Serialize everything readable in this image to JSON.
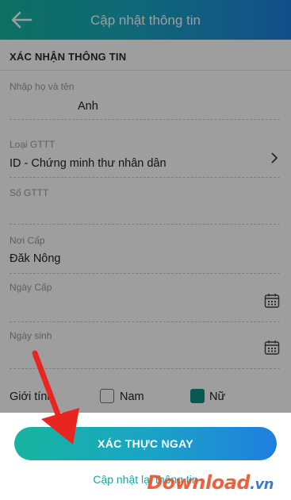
{
  "header": {
    "title": "Cập nhật thông tin",
    "back_icon": "arrow-left-icon"
  },
  "form": {
    "section_title": "XÁC NHẬN THÔNG TIN",
    "full_name": {
      "label": "Nhập họ và tên",
      "value": "Anh"
    },
    "id_type": {
      "label": "Loại GTTT",
      "value": "ID - Chứng minh thư nhân dân",
      "icon": "chevron-right-icon"
    },
    "id_number": {
      "label": "Số GTTT",
      "value": ""
    },
    "issue_place": {
      "label": "Nơi Cấp",
      "value": "Đăk Nông"
    },
    "issue_date": {
      "label": "Ngày Cấp",
      "value": "",
      "icon": "calendar-icon"
    },
    "birth_date": {
      "label": "Ngày sinh",
      "value": "",
      "icon": "calendar-icon"
    },
    "gender": {
      "label": "Giới tính",
      "options": [
        {
          "label": "Nam",
          "checked": false
        },
        {
          "label": "Nữ",
          "checked": true
        }
      ]
    }
  },
  "actions": {
    "primary_label": "XÁC THỰC NGAY",
    "secondary_label": "Cập nhật lại thông tin"
  },
  "annotation": {
    "icon": "red-arrow-icon",
    "color": "#e8251e"
  },
  "watermark": {
    "text": "Download",
    "suffix": ".vn"
  },
  "colors": {
    "accent_start": "#15b5a0",
    "accent_end": "#1e7fe0",
    "checkbox_checked": "#0f8f85"
  }
}
